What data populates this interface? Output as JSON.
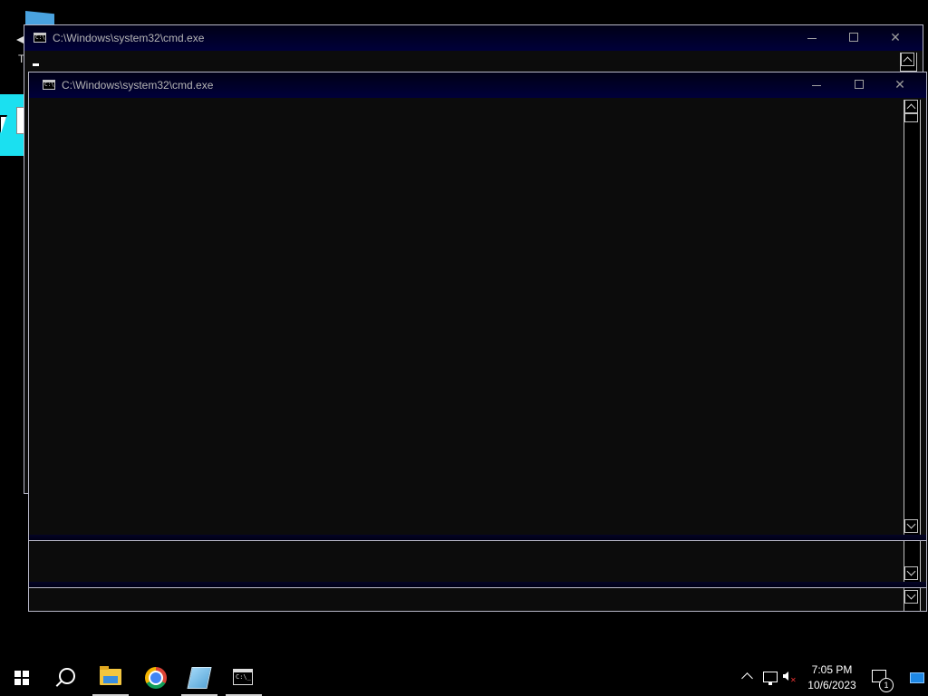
{
  "desktop": {
    "icon_letter": "T"
  },
  "windows": [
    {
      "title": "C:\\Windows\\system32\\cmd.exe"
    },
    {
      "title": "C:\\Windows\\system32\\cmd.exe"
    }
  ],
  "taskbar": {
    "apps": [
      "start-icon",
      "search-icon",
      "file-explorer-icon",
      "chrome-icon",
      "notepad-icon",
      "cmd-icon"
    ],
    "clock_time": "7:05 PM",
    "clock_date": "10/6/2023",
    "notification_count": "1"
  }
}
